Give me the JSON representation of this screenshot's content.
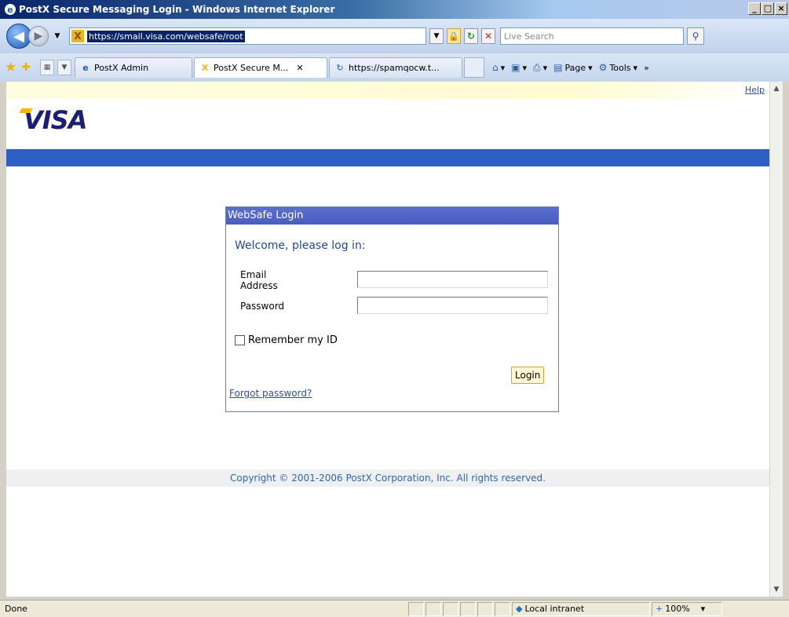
{
  "window": {
    "title": "PostX Secure Messaging Login - Windows Internet Explorer",
    "min": "_",
    "max": "□",
    "close": "×"
  },
  "address": {
    "url": "https://smail.visa.com/websafe/root",
    "search_placeholder": "Live Search"
  },
  "tabs": [
    {
      "label": "PostX Admin"
    },
    {
      "label": "PostX Secure M..."
    },
    {
      "label": "https://spamqocw.t..."
    }
  ],
  "commandbar": {
    "page": "Page",
    "tools": "Tools"
  },
  "page": {
    "help": "Help",
    "logo": "VISA",
    "login": {
      "header": "WebSafe Login",
      "welcome": "Welcome, please log in:",
      "email_label_1": "Email",
      "email_label_2": "Address",
      "password_label": "Password",
      "email_value": "",
      "password_value": "",
      "remember": "Remember my ID",
      "remember_checked": false,
      "login_button": "Login",
      "forgot": "Forgot password?"
    },
    "copyright": "Copyright © 2001-2006 PostX Corporation, Inc. All rights reserved."
  },
  "status": {
    "text": "Done",
    "zone": "Local intranet",
    "zoom": "100%"
  },
  "colors": {
    "visa_blue": "#1a1f71",
    "band_blue": "#2d5fc4",
    "login_header": "#4a5bbf"
  }
}
